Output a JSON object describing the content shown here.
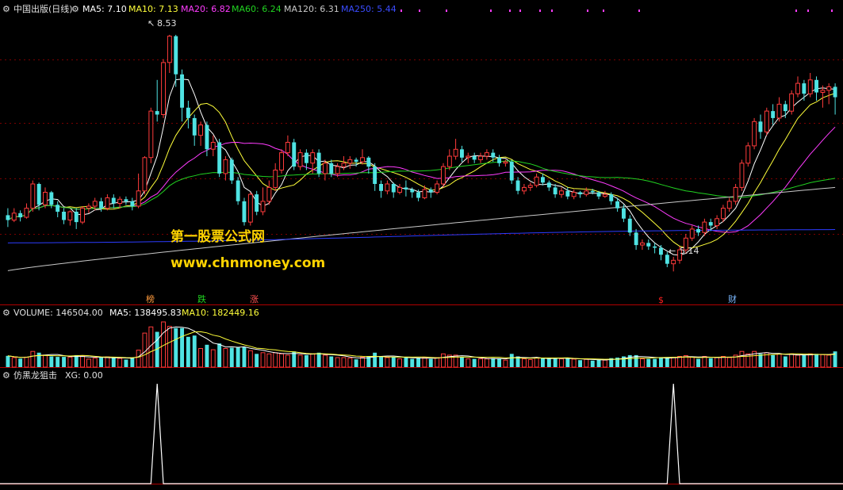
{
  "colors": {
    "bg": "#000000",
    "divider": "#b00000",
    "grid": "#7a0000",
    "up": "#ff3b3b",
    "down": "#4fe3e3",
    "ma5": "#ffffff",
    "ma10": "#ffff3a",
    "ma20": "#ff3cff",
    "ma60": "#21d321",
    "ma120": "#c8c8c8",
    "ma250": "#2c3cff",
    "signal": "#ffffff",
    "watermark": "#ffd400",
    "mark_bang": "#ff9a3c",
    "mark_die": "#21d321",
    "mark_zhang": "#ff5050",
    "mark_s": "#ff2020",
    "mark_cai": "#7ab8ff"
  },
  "header": {
    "title": "中国出版(日线)",
    "ma5": "MA5: 7.10",
    "ma10": "MA10: 7.13",
    "ma20": "MA20: 6.82",
    "ma60": "MA60: 6.24",
    "ma120": "MA120: 6.31",
    "ma250": "MA250: 5.44"
  },
  "volume_header": {
    "volume": "VOLUME: 146504.00",
    "ma5": "MA5: 138495.83",
    "ma10": "MA10: 182449.16"
  },
  "indicator_header": {
    "name": "仿黑龙狙击",
    "xg": "XG: 0.00"
  },
  "annotations": {
    "high": "8.53",
    "low": "5.14"
  },
  "marks": {
    "bang": "榜",
    "die": "跌",
    "zhang": "涨",
    "s": "$",
    "cai": "财"
  },
  "watermark": {
    "line1": "第一股票公式网",
    "line2": "www.chnmoney.com"
  },
  "chart_data": {
    "type": "candlestick",
    "price_range": [
      4.8,
      8.8
    ],
    "candles": [
      [
        5.95,
        5.88,
        6.05,
        5.78
      ],
      [
        5.88,
        5.98,
        6.05,
        5.85
      ],
      [
        5.98,
        5.92,
        6.02,
        5.86
      ],
      [
        5.92,
        6.05,
        6.12,
        5.9
      ],
      [
        6.05,
        6.4,
        6.45,
        6.0
      ],
      [
        6.4,
        6.1,
        6.42,
        6.02
      ],
      [
        6.1,
        6.28,
        6.35,
        6.05
      ],
      [
        6.28,
        6.1,
        6.3,
        6.05
      ],
      [
        6.1,
        6.0,
        6.15,
        5.92
      ],
      [
        6.0,
        5.88,
        6.05,
        5.82
      ],
      [
        5.88,
        6.0,
        6.02,
        5.8
      ],
      [
        6.0,
        5.85,
        6.05,
        5.75
      ],
      [
        5.85,
        6.05,
        6.08,
        5.82
      ],
      [
        6.05,
        6.08,
        6.12,
        5.98
      ],
      [
        6.08,
        6.15,
        6.2,
        6.02
      ],
      [
        6.15,
        6.05,
        6.2,
        6.0
      ],
      [
        6.05,
        6.2,
        6.25,
        6.02
      ],
      [
        6.2,
        6.12,
        6.25,
        6.05
      ],
      [
        6.12,
        6.18,
        6.22,
        6.05
      ],
      [
        6.18,
        6.15,
        6.22,
        6.1
      ],
      [
        6.15,
        6.08,
        6.2,
        6.02
      ],
      [
        6.08,
        6.3,
        6.55,
        6.05
      ],
      [
        6.3,
        6.78,
        6.8,
        6.25
      ],
      [
        6.78,
        7.45,
        7.5,
        6.7
      ],
      [
        7.45,
        7.4,
        7.9,
        7.3
      ],
      [
        7.4,
        8.15,
        8.2,
        7.35
      ],
      [
        8.15,
        8.53,
        8.55,
        8.0
      ],
      [
        8.53,
        7.98,
        8.55,
        7.8
      ],
      [
        7.98,
        7.5,
        8.05,
        7.3
      ],
      [
        7.5,
        7.35,
        7.6,
        7.2
      ],
      [
        7.35,
        7.1,
        7.4,
        6.95
      ],
      [
        7.1,
        7.25,
        7.3,
        6.95
      ],
      [
        7.25,
        6.9,
        7.3,
        6.8
      ],
      [
        6.9,
        7.0,
        7.1,
        6.8
      ],
      [
        7.0,
        6.55,
        7.05,
        6.5
      ],
      [
        6.55,
        6.75,
        6.8,
        6.45
      ],
      [
        6.75,
        6.45,
        6.78,
        6.4
      ],
      [
        6.45,
        6.15,
        6.5,
        6.1
      ],
      [
        6.15,
        5.85,
        6.2,
        5.8
      ],
      [
        5.85,
        6.25,
        6.28,
        5.8
      ],
      [
        6.25,
        6.0,
        6.3,
        5.95
      ],
      [
        6.0,
        6.15,
        6.35,
        5.95
      ],
      [
        6.15,
        6.35,
        6.45,
        6.1
      ],
      [
        6.35,
        6.6,
        6.7,
        6.3
      ],
      [
        6.6,
        6.85,
        6.9,
        6.55
      ],
      [
        6.85,
        7.0,
        7.1,
        6.8
      ],
      [
        7.0,
        6.65,
        7.05,
        6.6
      ],
      [
        6.65,
        6.85,
        6.9,
        6.6
      ],
      [
        6.85,
        6.7,
        6.9,
        6.6
      ],
      [
        6.7,
        6.85,
        6.9,
        6.55
      ],
      [
        6.85,
        6.55,
        6.9,
        6.5
      ],
      [
        6.55,
        6.7,
        6.75,
        6.45
      ],
      [
        6.7,
        6.55,
        6.75,
        6.5
      ],
      [
        6.55,
        6.65,
        6.7,
        6.5
      ],
      [
        6.65,
        6.7,
        6.8,
        6.6
      ],
      [
        6.7,
        6.75,
        6.8,
        6.62
      ],
      [
        6.75,
        6.72,
        6.78,
        6.65
      ],
      [
        6.72,
        6.78,
        6.9,
        6.68
      ],
      [
        6.78,
        6.65,
        6.8,
        6.55
      ],
      [
        6.65,
        6.4,
        6.7,
        6.3
      ],
      [
        6.4,
        6.3,
        6.45,
        6.2
      ],
      [
        6.3,
        6.4,
        6.45,
        6.25
      ],
      [
        6.4,
        6.28,
        6.42,
        6.2
      ],
      [
        6.28,
        6.35,
        6.4,
        6.25
      ],
      [
        6.35,
        6.32,
        6.45,
        6.22
      ],
      [
        6.32,
        6.28,
        6.35,
        6.2
      ],
      [
        6.28,
        6.2,
        6.32,
        6.15
      ],
      [
        6.2,
        6.32,
        6.38,
        6.18
      ],
      [
        6.32,
        6.28,
        6.35,
        6.2
      ],
      [
        6.28,
        6.4,
        6.45,
        6.25
      ],
      [
        6.4,
        6.65,
        6.7,
        6.35
      ],
      [
        6.65,
        6.8,
        6.9,
        6.6
      ],
      [
        6.8,
        6.9,
        7.05,
        6.75
      ],
      [
        6.9,
        6.78,
        6.95,
        6.72
      ],
      [
        6.78,
        6.8,
        6.85,
        6.7
      ],
      [
        6.8,
        6.75,
        6.85,
        6.7
      ],
      [
        6.75,
        6.8,
        6.85,
        6.7
      ],
      [
        6.8,
        6.85,
        6.9,
        6.75
      ],
      [
        6.85,
        6.78,
        6.9,
        6.72
      ],
      [
        6.78,
        6.7,
        6.82,
        6.65
      ],
      [
        6.7,
        6.72,
        6.75,
        6.65
      ],
      [
        6.72,
        6.45,
        6.75,
        6.4
      ],
      [
        6.45,
        6.3,
        6.5,
        6.25
      ],
      [
        6.3,
        6.35,
        6.4,
        6.25
      ],
      [
        6.35,
        6.38,
        6.42,
        6.3
      ],
      [
        6.38,
        6.5,
        6.55,
        6.35
      ],
      [
        6.5,
        6.42,
        6.55,
        6.38
      ],
      [
        6.42,
        6.35,
        6.45,
        6.3
      ],
      [
        6.35,
        6.25,
        6.4,
        6.2
      ],
      [
        6.25,
        6.3,
        6.35,
        6.2
      ],
      [
        6.3,
        6.22,
        6.35,
        6.18
      ],
      [
        6.22,
        6.28,
        6.32,
        6.18
      ],
      [
        6.28,
        6.25,
        6.3,
        6.2
      ],
      [
        6.25,
        6.3,
        6.35,
        6.22
      ],
      [
        6.3,
        6.28,
        6.33,
        6.25
      ],
      [
        6.28,
        6.22,
        6.3,
        6.18
      ],
      [
        6.22,
        6.25,
        6.3,
        6.2
      ],
      [
        6.25,
        6.15,
        6.28,
        6.1
      ],
      [
        6.15,
        6.05,
        6.2,
        6.0
      ],
      [
        6.05,
        5.9,
        6.1,
        5.85
      ],
      [
        5.9,
        5.7,
        5.95,
        5.65
      ],
      [
        5.7,
        5.52,
        5.75,
        5.45
      ],
      [
        5.52,
        5.55,
        5.6,
        5.45
      ],
      [
        5.55,
        5.5,
        5.6,
        5.45
      ],
      [
        5.5,
        5.48,
        5.55,
        5.4
      ],
      [
        5.48,
        5.38,
        5.52,
        5.3
      ],
      [
        5.38,
        5.25,
        5.42,
        5.2
      ],
      [
        5.25,
        5.3,
        5.35,
        5.14
      ],
      [
        5.3,
        5.45,
        5.5,
        5.25
      ],
      [
        5.45,
        5.62,
        5.68,
        5.4
      ],
      [
        5.62,
        5.75,
        5.8,
        5.58
      ],
      [
        5.75,
        5.7,
        5.8,
        5.65
      ],
      [
        5.7,
        5.85,
        5.9,
        5.65
      ],
      [
        5.85,
        5.8,
        5.9,
        5.72
      ],
      [
        5.8,
        5.9,
        5.95,
        5.75
      ],
      [
        5.9,
        6.05,
        6.1,
        5.85
      ],
      [
        6.05,
        6.15,
        6.2,
        6.0
      ],
      [
        6.15,
        6.35,
        6.4,
        6.1
      ],
      [
        6.35,
        6.7,
        6.75,
        6.3
      ],
      [
        6.7,
        6.95,
        7.0,
        6.65
      ],
      [
        6.95,
        7.3,
        7.35,
        6.9
      ],
      [
        7.3,
        7.15,
        7.4,
        7.05
      ],
      [
        7.15,
        7.45,
        7.5,
        7.1
      ],
      [
        7.45,
        7.35,
        7.55,
        7.25
      ],
      [
        7.35,
        7.55,
        7.65,
        7.3
      ],
      [
        7.55,
        7.45,
        7.6,
        7.35
      ],
      [
        7.45,
        7.7,
        7.75,
        7.4
      ],
      [
        7.7,
        7.85,
        7.95,
        7.65
      ],
      [
        7.85,
        7.7,
        7.9,
        7.6
      ],
      [
        7.7,
        7.9,
        8.0,
        7.65
      ],
      [
        7.9,
        7.72,
        7.95,
        7.6
      ],
      [
        7.72,
        7.75,
        7.82,
        7.5
      ],
      [
        7.75,
        7.8,
        7.85,
        7.55
      ],
      [
        7.8,
        7.65,
        7.85,
        7.4
      ]
    ],
    "signal_indices": [
      24,
      107
    ]
  }
}
